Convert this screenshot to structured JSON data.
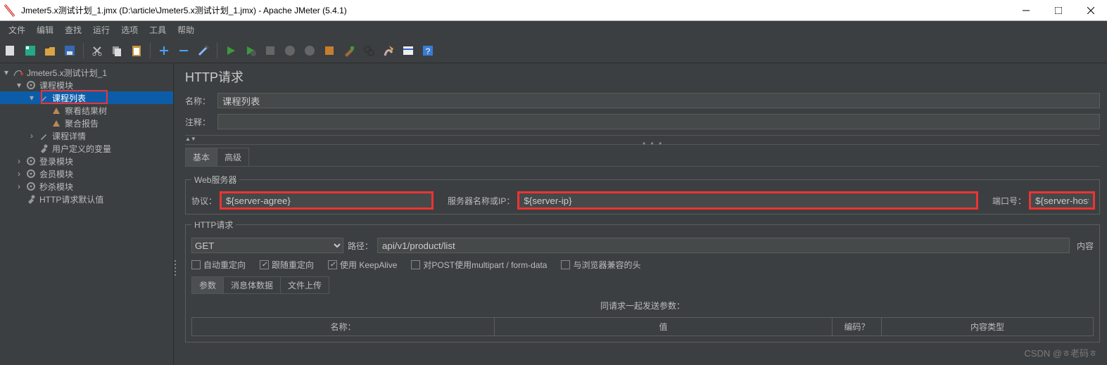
{
  "window": {
    "title": "Jmeter5.x测试计划_1.jmx (D:\\article\\Jmeter5.x测试计划_1.jmx) - Apache JMeter (5.4.1)"
  },
  "menu": {
    "items": [
      "文件",
      "编辑",
      "查找",
      "运行",
      "选项",
      "工具",
      "帮助"
    ]
  },
  "tree": {
    "root": "Jmeter5.x测试计划_1",
    "items": [
      {
        "label": "课程模块",
        "depth": 1,
        "twist": "▾",
        "icon": "gear"
      },
      {
        "label": "课程列表",
        "depth": 2,
        "twist": "▾",
        "icon": "pipette",
        "sel": true
      },
      {
        "label": "察看结果树",
        "depth": 3,
        "twist": "",
        "icon": "triangle"
      },
      {
        "label": "聚合报告",
        "depth": 3,
        "twist": "",
        "icon": "triangle"
      },
      {
        "label": "课程详情",
        "depth": 2,
        "twist": "›",
        "icon": "pipette"
      },
      {
        "label": "用户定义的变量",
        "depth": 2,
        "twist": "",
        "icon": "wrench"
      },
      {
        "label": "登录模块",
        "depth": 1,
        "twist": "›",
        "icon": "gear"
      },
      {
        "label": "会员模块",
        "depth": 1,
        "twist": "›",
        "icon": "gear"
      },
      {
        "label": "秒杀模块",
        "depth": 1,
        "twist": "›",
        "icon": "gear"
      },
      {
        "label": "HTTP请求默认值",
        "depth": 1,
        "twist": "",
        "icon": "wrench"
      }
    ]
  },
  "main": {
    "title": "HTTP请求",
    "name_label": "名称：",
    "name_value": "课程列表",
    "comment_label": "注释：",
    "comment_value": "",
    "tab_basic": "基本",
    "tab_adv": "高级",
    "web_legend": "Web服务器",
    "protocol_label": "协议：",
    "protocol_value": "${server-agree}",
    "server_label": "服务器名称或IP：",
    "server_value": "${server-ip}",
    "port_label": "端口号：",
    "port_value": "${server-host}",
    "http_legend": "HTTP请求",
    "method": "GET",
    "path_label": "路径：",
    "path_value": "api/v1/product/list",
    "content_enc": "内容",
    "ck_autoredir": "自动重定向",
    "ck_followredir": "跟随重定向",
    "ck_keepalive": "使用 KeepAlive",
    "ck_multipart": "对POST使用multipart / form-data",
    "ck_browser": "与浏览器兼容的头",
    "subtab_params": "参数",
    "subtab_body": "消息体数据",
    "subtab_files": "文件上传",
    "params_header": "同请求一起发送参数：",
    "col_name": "名称：",
    "col_value": "值",
    "col_enc": "编码？",
    "col_ctype": "内容类型"
  },
  "watermark": "CSDN @ㅎ老码ㅎ"
}
